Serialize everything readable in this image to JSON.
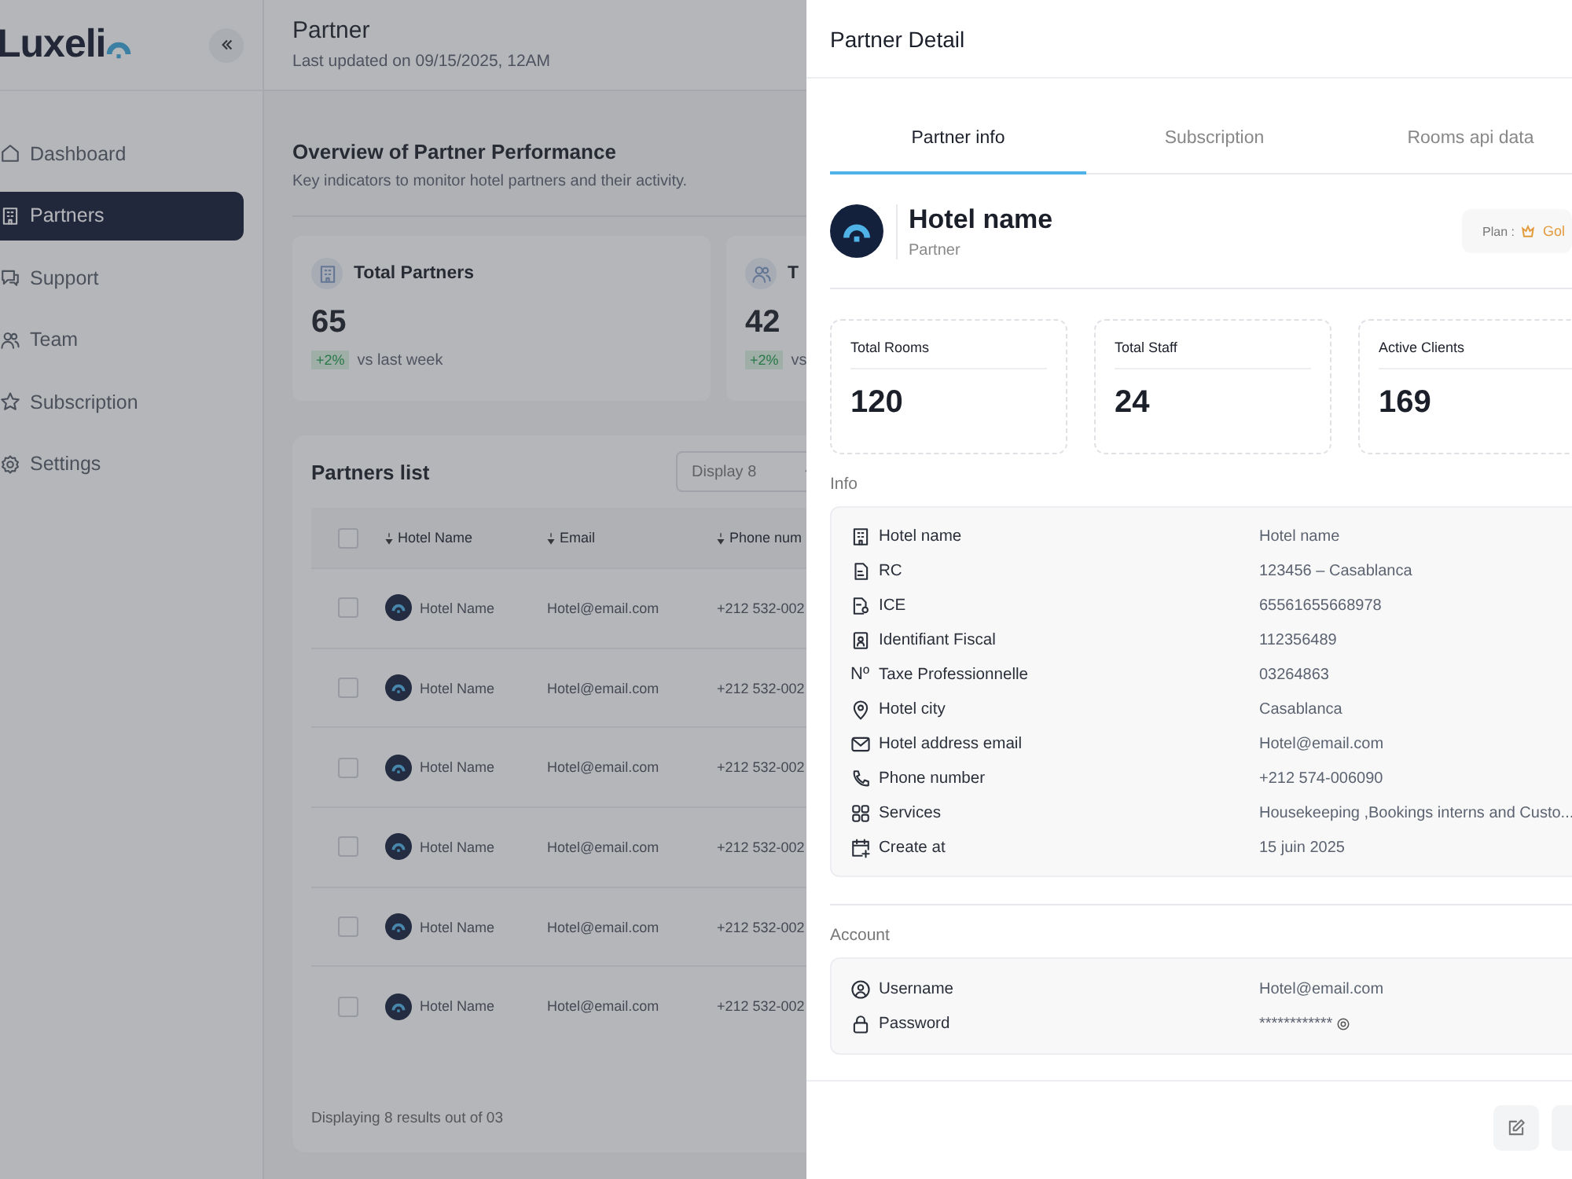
{
  "sidebar": {
    "logo": "Luxeli",
    "items": [
      {
        "label": "Dashboard",
        "selected": false
      },
      {
        "label": "Partners",
        "selected": true
      },
      {
        "label": "Support",
        "selected": false
      },
      {
        "label": "Team",
        "selected": false
      },
      {
        "label": "Subscription",
        "selected": false
      },
      {
        "label": "Settings",
        "selected": false
      }
    ]
  },
  "header": {
    "title": "Partner",
    "subtitle": "Last updated on 09/15/2025, 12AM"
  },
  "overview": {
    "title": "Overview of Partner Performance",
    "description": "Key indicators to monitor hotel partners and their activity."
  },
  "stat_cards": [
    {
      "title": "Total Partners",
      "value": "65",
      "change": "+2%",
      "note": "vs last week"
    },
    {
      "title": "T",
      "value": "42",
      "change": "+2%",
      "note": "vs"
    }
  ],
  "partners_list": {
    "title": "Partners list",
    "display": "Display 8",
    "select_all_checked": false,
    "columns": [
      "Hotel Name",
      "Email",
      "Phone num"
    ],
    "rows": [
      {
        "checked": false,
        "hotel": "Hotel Name",
        "email": "Hotel@email.com",
        "phone": "+212 532-002"
      },
      {
        "checked": false,
        "hotel": "Hotel Name",
        "email": "Hotel@email.com",
        "phone": "+212 532-002"
      },
      {
        "checked": false,
        "hotel": "Hotel Name",
        "email": "Hotel@email.com",
        "phone": "+212 532-002"
      },
      {
        "checked": false,
        "hotel": "Hotel Name",
        "email": "Hotel@email.com",
        "phone": "+212 532-002"
      },
      {
        "checked": false,
        "hotel": "Hotel Name",
        "email": "Hotel@email.com",
        "phone": "+212 532-002"
      },
      {
        "checked": false,
        "hotel": "Hotel Name",
        "email": "Hotel@email.com",
        "phone": "+212 532-002"
      }
    ],
    "footer": "Displaying 8 results out of 03"
  },
  "drawer": {
    "title": "Partner Detail",
    "tabs": [
      {
        "label": "Partner info",
        "selected": true
      },
      {
        "label": "Subscription",
        "selected": false
      },
      {
        "label": "Rooms api data",
        "selected": false
      }
    ],
    "hotel": {
      "name": "Hotel name",
      "role": "Partner",
      "plan_label": "Plan :",
      "plan": "Gol"
    },
    "stats": [
      {
        "label": "Total Rooms",
        "value": "120"
      },
      {
        "label": "Total Staff",
        "value": "24"
      },
      {
        "label": "Active Clients",
        "value": "169"
      }
    ],
    "info_title": "Info",
    "info": [
      {
        "kind": "icon",
        "label": "Hotel name",
        "value": "Hotel name"
      },
      {
        "kind": "icon",
        "label": "RC",
        "value": "123456 – Casablanca"
      },
      {
        "kind": "icon",
        "label": "ICE",
        "value": "65561655668978"
      },
      {
        "kind": "icon",
        "label": "Identifiant Fiscal",
        "value": "112356489"
      },
      {
        "kind": "symbol",
        "symbol": "Nº",
        "label": "Taxe Professionnelle",
        "value": "03264863"
      },
      {
        "kind": "icon",
        "label": "Hotel city",
        "value": "Casablanca"
      },
      {
        "kind": "icon",
        "label": "Hotel address email",
        "value": "Hotel@email.com"
      },
      {
        "kind": "icon",
        "label": "Phone number",
        "value": "+212 574-006090"
      },
      {
        "kind": "icon",
        "label": "Services",
        "value": "Housekeeping ,Bookings interns and Custo..."
      },
      {
        "kind": "icon",
        "label": "Create at",
        "value": "15 juin 2025"
      }
    ],
    "account_title": "Account",
    "account": [
      {
        "label": "Username",
        "value": "Hotel@email.com"
      },
      {
        "label": "Password",
        "value": "************"
      }
    ]
  }
}
